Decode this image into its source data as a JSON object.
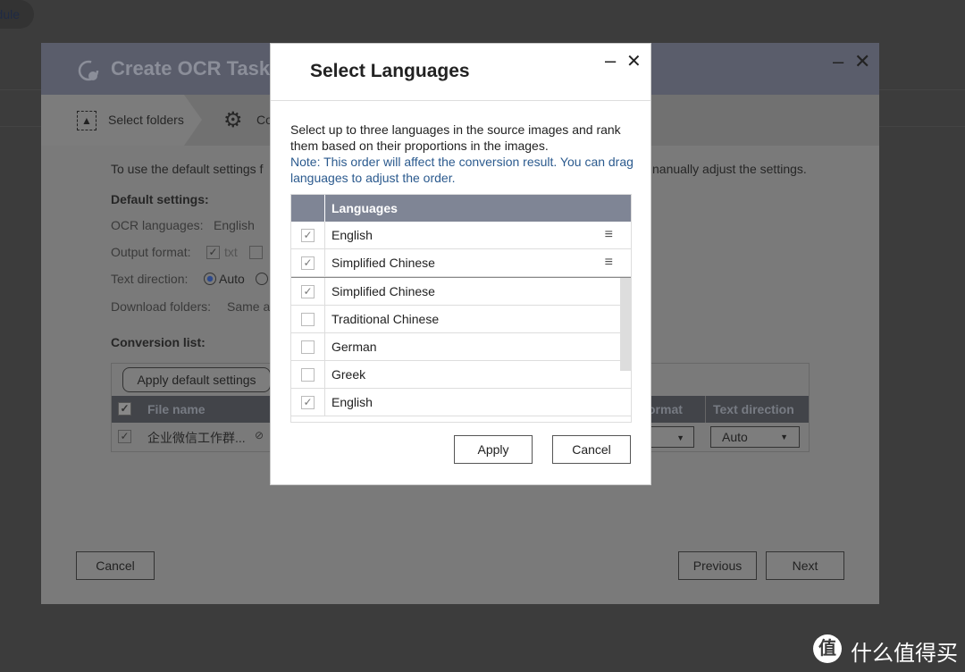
{
  "background": {
    "pill_text": "dule",
    "watermark": "什么值得买",
    "watermark_logo": "值"
  },
  "window": {
    "title": "Create OCR Task",
    "steps": [
      "Select folders",
      "Co"
    ],
    "intro_left": "To use the default settings f",
    "intro_right": "nanually adjust the settings.",
    "default_settings_label": "Default settings:",
    "ocr_languages_label": "OCR languages:",
    "ocr_languages_value": "English",
    "output_format_label": "Output format:",
    "output_format_value": "txt",
    "text_direction_label": "Text direction:",
    "text_direction_value": "Auto",
    "download_folders_label": "Download folders:",
    "download_folders_value": "Same a",
    "conversion_list_label": "Conversion list:",
    "apply_default_label": "Apply default settings",
    "columns": [
      "File name",
      "ormat",
      "Text direction"
    ],
    "row": {
      "file_name": "企业微信工作群...",
      "text_direction": "Auto"
    },
    "cancel": "Cancel",
    "previous": "Previous",
    "next": "Next"
  },
  "modal": {
    "title": "Select Languages",
    "description": "Select up to three languages in the source images and rank them based on their proportions in the images.",
    "note": "Note: This order will affect the conversion result. You can drag languages to adjust the order.",
    "column": "Languages",
    "selected": [
      {
        "label": "English",
        "checked": true
      },
      {
        "label": "Simplified Chinese",
        "checked": true
      }
    ],
    "options": [
      {
        "label": "Simplified Chinese",
        "checked": true
      },
      {
        "label": "Traditional Chinese",
        "checked": false
      },
      {
        "label": "German",
        "checked": false
      },
      {
        "label": "Greek",
        "checked": false
      },
      {
        "label": "English",
        "checked": true
      }
    ],
    "apply": "Apply",
    "cancel": "Cancel"
  }
}
